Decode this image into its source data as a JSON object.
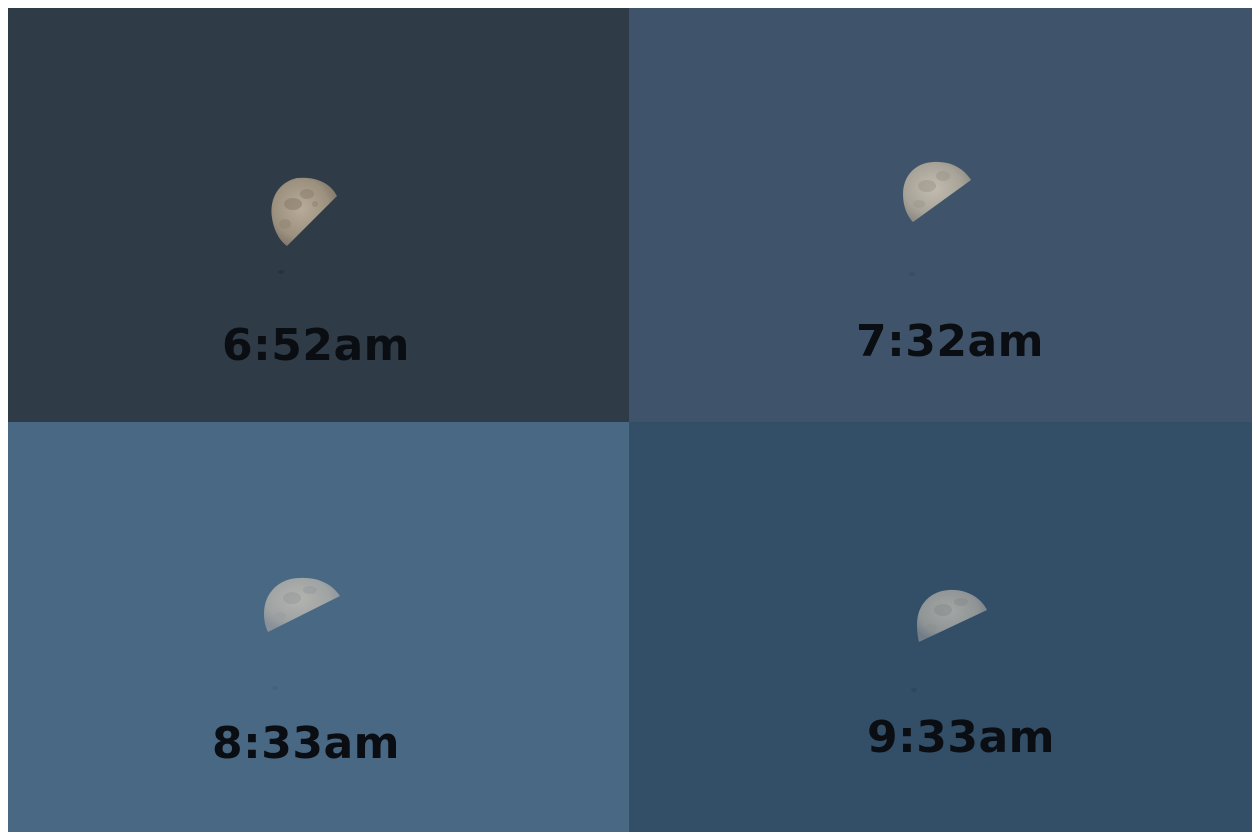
{
  "panels": [
    {
      "time": "6:52am",
      "sky_color": "#2f3b46",
      "label_color": "#0a0d12"
    },
    {
      "time": "7:32am",
      "sky_color": "#3f546b",
      "label_color": "#0a0d12"
    },
    {
      "time": "8:33am",
      "sky_color": "#496884",
      "label_color": "#0a0d12"
    },
    {
      "time": "9:33am",
      "sky_color": "#334e67",
      "label_color": "#0a0d12"
    }
  ]
}
